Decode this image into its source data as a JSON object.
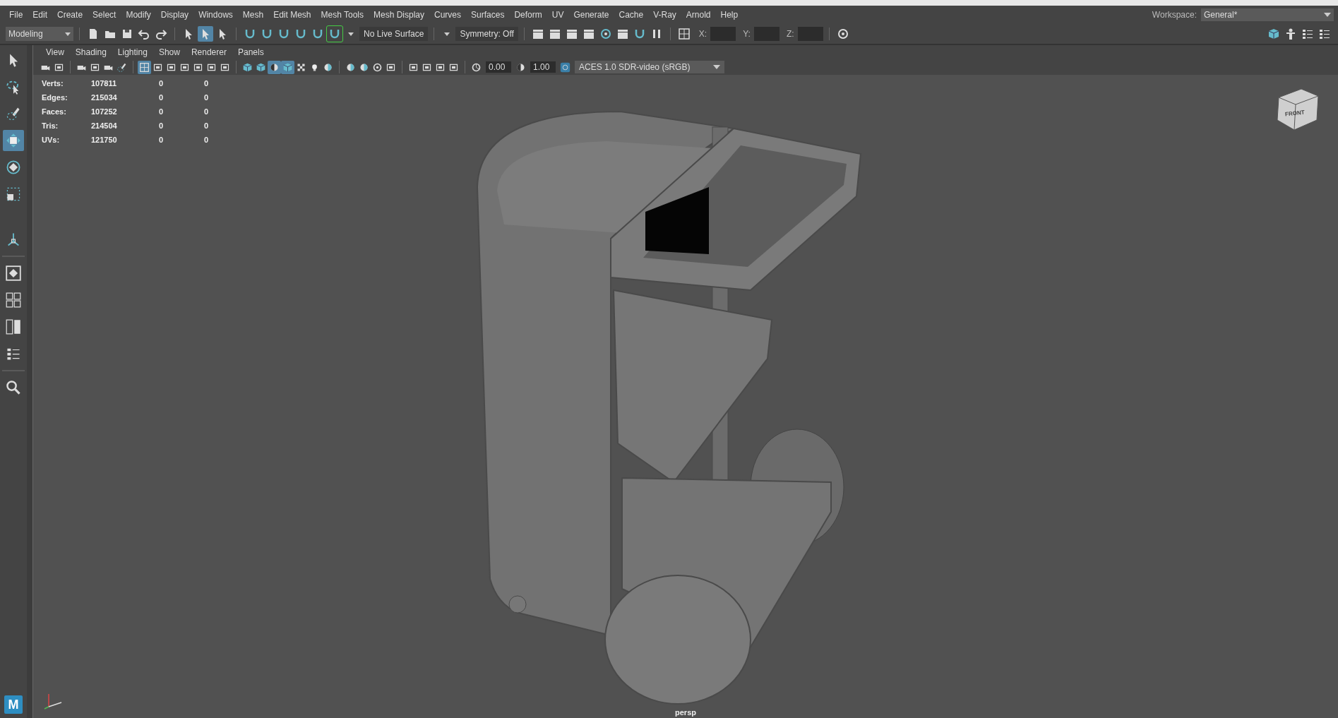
{
  "menu_bar": {
    "items": [
      "File",
      "Edit",
      "Create",
      "Select",
      "Modify",
      "Display",
      "Windows",
      "Mesh",
      "Edit Mesh",
      "Mesh Tools",
      "Mesh Display",
      "Curves",
      "Surfaces",
      "Deform",
      "UV",
      "Generate",
      "Cache",
      "V-Ray",
      "Arnold",
      "Help"
    ],
    "workspace_label": "Workspace:",
    "workspace_value": "General*"
  },
  "status_line": {
    "mode": "Modeling",
    "selection_modes": [
      {
        "selected": false
      },
      {
        "selected": true
      },
      {
        "selected": false
      }
    ],
    "live_surface": "No Live Surface",
    "symmetry": "Symmetry: Off",
    "x_label": "X:",
    "y_label": "Y:",
    "z_label": "Z:"
  },
  "tools": [
    {
      "kind": "select",
      "selected": false
    },
    {
      "kind": "lasso",
      "selected": false
    },
    {
      "kind": "paint",
      "selected": false
    },
    {
      "kind": "move",
      "selected": true
    },
    {
      "kind": "rotate",
      "selected": false
    },
    {
      "kind": "scale",
      "selected": false
    }
  ],
  "logo": "M",
  "panel": {
    "menu": [
      "View",
      "Shading",
      "Lighting",
      "Show",
      "Renderer",
      "Panels"
    ],
    "display_toggles": [
      {
        "selected": true
      },
      {
        "selected": false
      },
      {
        "selected": false
      },
      {
        "selected": true
      },
      {
        "selected": true
      }
    ],
    "exposure": "0.00",
    "gamma": "1.00",
    "color_space": "ACES 1.0 SDR-video (sRGB)"
  },
  "stats": [
    {
      "label": "Verts:",
      "values": [
        "107811",
        "0",
        "0"
      ]
    },
    {
      "label": "Edges:",
      "values": [
        "215034",
        "0",
        "0"
      ]
    },
    {
      "label": "Faces:",
      "values": [
        "107252",
        "0",
        "0"
      ]
    },
    {
      "label": "Tris:",
      "values": [
        "214504",
        "0",
        "0"
      ]
    },
    {
      "label": "UVs:",
      "values": [
        "121750",
        "0",
        "0"
      ]
    }
  ],
  "viewport": {
    "camera": "persp",
    "view_cube_label": "FRONT"
  }
}
